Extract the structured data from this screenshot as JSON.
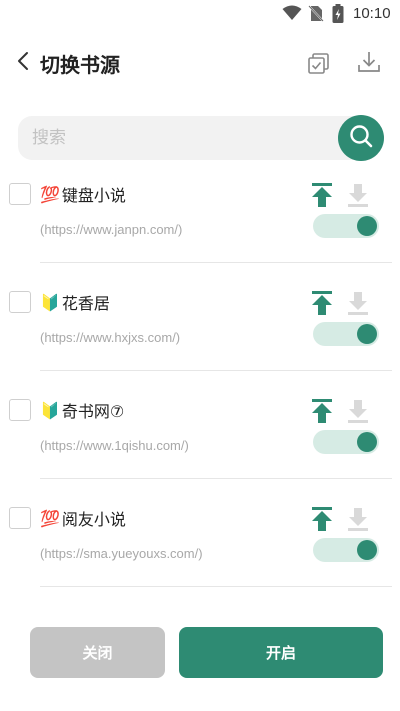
{
  "status_bar": {
    "time": "10:10",
    "icons": [
      "wifi-icon",
      "no-sim-icon",
      "battery-charging-icon"
    ]
  },
  "header": {
    "title": "切换书源",
    "back_icon": "chevron-left-icon",
    "select_all_icon": "copy-check-icon",
    "download_icon": "download-icon"
  },
  "search": {
    "placeholder": "搜索",
    "value": "",
    "icon": "search-icon"
  },
  "sources": [
    {
      "badge": "💯",
      "name": "键盘小说",
      "url": "(https://www.janpn.com/)",
      "checked": false,
      "enabled": true
    },
    {
      "badge": "🔰",
      "name": "花香居",
      "url": "(https://www.hxjxs.com/)",
      "checked": false,
      "enabled": true
    },
    {
      "badge": "🔰",
      "name": "奇书网⑦",
      "url": "(https://www.1qishu.com/)",
      "checked": false,
      "enabled": true
    },
    {
      "badge": "💯",
      "name": "阅友小说",
      "url": "(https://sma.yueyouxs.com/)",
      "checked": false,
      "enabled": true
    }
  ],
  "item_actions": {
    "top_icon": "move-to-top-icon",
    "download_icon": "download-arrow-icon"
  },
  "footer": {
    "close_label": "关闭",
    "open_label": "开启"
  },
  "colors": {
    "accent": "#2e8b73",
    "toggle_track": "#d6ebe4",
    "close_button": "#c4c4c4",
    "search_bg": "#f2f2f2"
  }
}
